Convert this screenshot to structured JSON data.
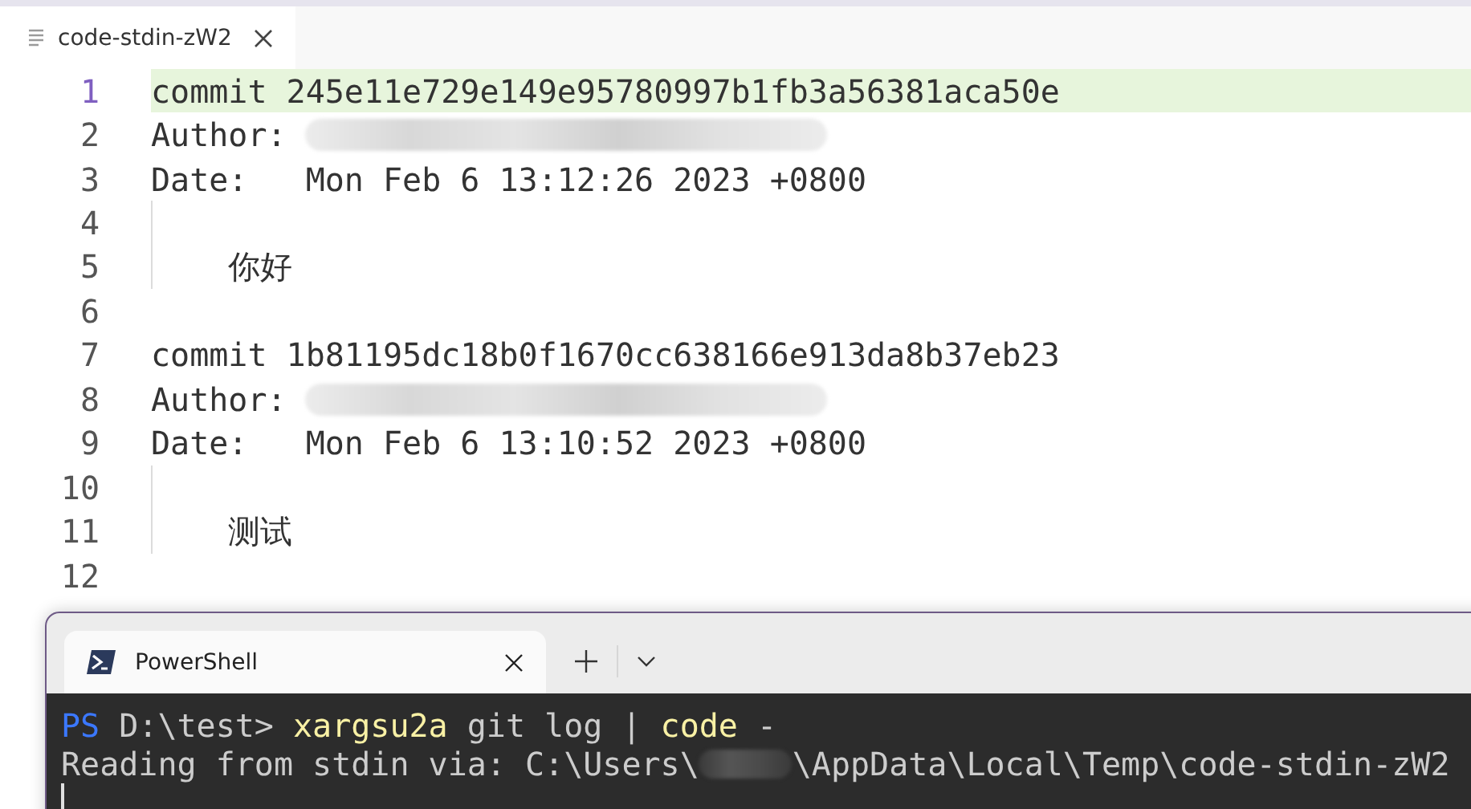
{
  "editor": {
    "tab": {
      "title": "code-stdin-zW2",
      "selected": true
    },
    "lines": [
      {
        "number": "1",
        "text": "commit 245e11e729e149e95780997b1fb3a56381aca50e",
        "active": true,
        "redacted": false,
        "guide": false
      },
      {
        "number": "2",
        "text": "Author:",
        "active": false,
        "redacted": true,
        "guide": false
      },
      {
        "number": "3",
        "text": "Date:   Mon Feb 6 13:12:26 2023 +0800",
        "active": false,
        "redacted": false,
        "guide": false
      },
      {
        "number": "4",
        "active": false,
        "redacted": false,
        "guide": true
      },
      {
        "number": "5",
        "text": "    你好",
        "active": false,
        "redacted": false,
        "guide": true
      },
      {
        "number": "6",
        "active": false,
        "redacted": false,
        "guide": false
      },
      {
        "number": "7",
        "text": "commit 1b81195dc18b0f1670cc638166e913da8b37eb23",
        "active": false,
        "redacted": false,
        "guide": false
      },
      {
        "number": "8",
        "text": "Author:",
        "active": false,
        "redacted": true,
        "guide": false
      },
      {
        "number": "9",
        "text": "Date:   Mon Feb 6 13:10:52 2023 +0800",
        "active": false,
        "redacted": false,
        "guide": false
      },
      {
        "number": "10",
        "active": false,
        "redacted": false,
        "guide": true
      },
      {
        "number": "11",
        "text": "    测试",
        "active": false,
        "redacted": false,
        "guide": true
      },
      {
        "number": "12",
        "active": false,
        "redacted": false,
        "guide": false
      }
    ]
  },
  "terminal": {
    "tab": {
      "title": "PowerShell",
      "selected": true
    },
    "lines": [
      [
        {
          "kind": "prompt",
          "text": "PS"
        },
        {
          "kind": "plain",
          "text": " D:\\test> "
        },
        {
          "kind": "command",
          "text": "xargsu2a"
        },
        {
          "kind": "plain",
          "text": " git log | "
        },
        {
          "kind": "command",
          "text": "code"
        },
        {
          "kind": "plain",
          "text": " -"
        }
      ],
      [
        {
          "kind": "plain",
          "text": "Reading from stdin via: C:\\Users\\"
        },
        {
          "kind": "redacted"
        },
        {
          "kind": "plain",
          "text": "\\AppData\\Local\\Temp\\code-stdin-zW2"
        }
      ]
    ],
    "cursor": true
  }
}
